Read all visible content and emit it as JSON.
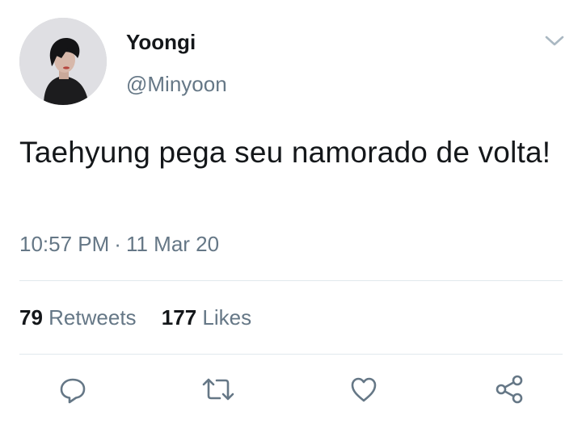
{
  "author": {
    "name": "Yoongi",
    "handle": "@Minyoon"
  },
  "tweet": {
    "text": "Taehyung pega seu namorado de volta!",
    "time": "10:57 PM",
    "separator": "·",
    "date": "11 Mar 20"
  },
  "stats": {
    "retweets_count": "79",
    "retweets_label": "Retweets",
    "likes_count": "177",
    "likes_label": "Likes"
  },
  "icons": {
    "menu": "chevron-down-icon",
    "reply": "reply-icon",
    "retweet": "retweet-icon",
    "like": "heart-icon",
    "share": "share-icon"
  },
  "colors": {
    "text": "#14171a",
    "secondary": "#657786",
    "divider": "#e1e8ed"
  }
}
